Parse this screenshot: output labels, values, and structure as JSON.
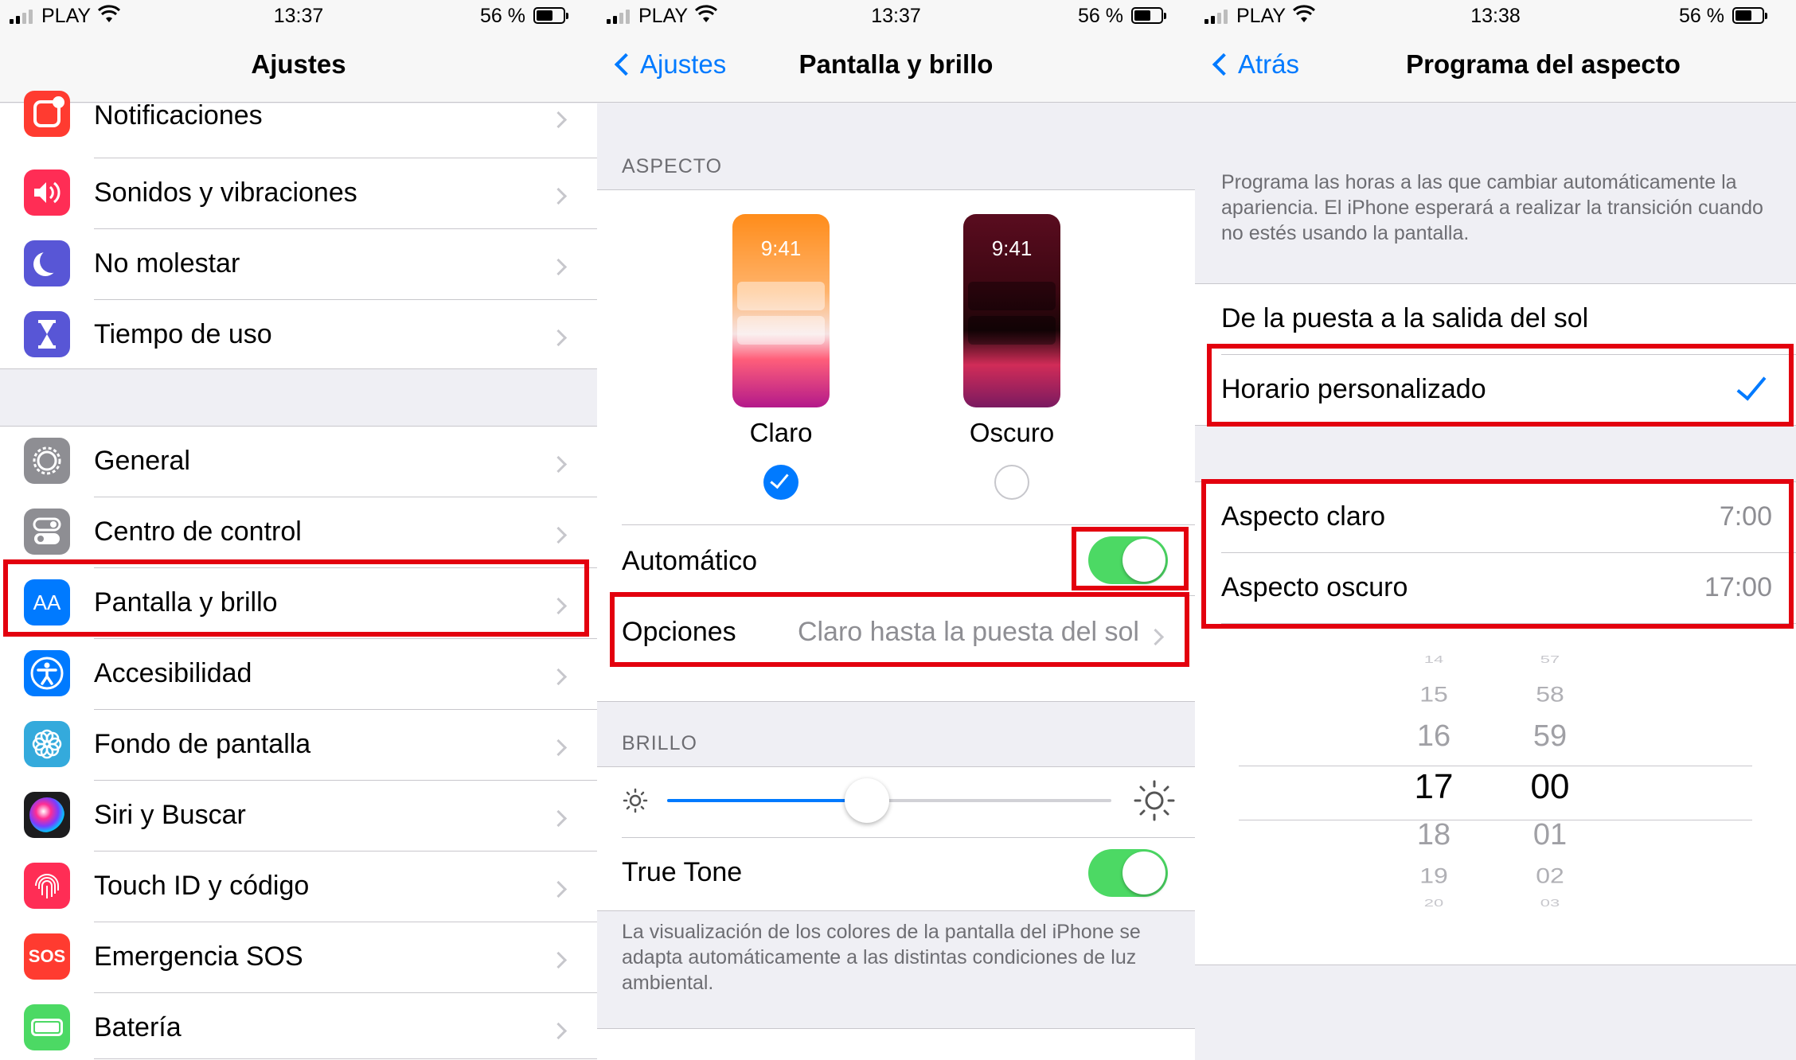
{
  "status_bars": [
    {
      "carrier": "PLAY",
      "time": "13:37",
      "battery": "56 %"
    },
    {
      "carrier": "PLAY",
      "time": "13:37",
      "battery": "56 %"
    },
    {
      "carrier": "PLAY",
      "time": "13:38",
      "battery": "56 %"
    }
  ],
  "panel1": {
    "title": "Ajustes",
    "group1": [
      {
        "label": "Notificaciones",
        "icon": "notifications-icon",
        "color": "#ff3b30"
      },
      {
        "label": "Sonidos y vibraciones",
        "icon": "speaker-icon",
        "color": "#ff2d55"
      },
      {
        "label": "No molestar",
        "icon": "moon-icon",
        "color": "#5856d6"
      },
      {
        "label": "Tiempo de uso",
        "icon": "hourglass-icon",
        "color": "#5856d6"
      }
    ],
    "group2": [
      {
        "label": "General",
        "icon": "gear-icon",
        "color": "#8e8e93"
      },
      {
        "label": "Centro de control",
        "icon": "switches-icon",
        "color": "#8e8e93"
      },
      {
        "label": "Pantalla y brillo",
        "icon": "display-icon",
        "color": "#007aff",
        "icon_text": "AA"
      },
      {
        "label": "Accesibilidad",
        "icon": "accessibility-icon",
        "color": "#007aff"
      },
      {
        "label": "Fondo de pantalla",
        "icon": "wallpaper-flower-icon",
        "color": "#34aadc"
      },
      {
        "label": "Siri y Buscar",
        "icon": "siri-icon",
        "color": "#1c1c1e"
      },
      {
        "label": "Touch ID y código",
        "icon": "fingerprint-icon",
        "color": "#ff2d55"
      },
      {
        "label": "Emergencia SOS",
        "icon": "sos-icon",
        "color": "#ff3b30",
        "icon_text": "SOS"
      },
      {
        "label": "Batería",
        "icon": "battery-icon",
        "color": "#4cd964"
      }
    ]
  },
  "panel2": {
    "back_label": "Ajustes",
    "title": "Pantalla y brillo",
    "aspect_header": "ASPECTO",
    "light": {
      "label": "Claro",
      "preview_time": "9:41",
      "selected": true
    },
    "dark": {
      "label": "Oscuro",
      "preview_time": "9:41",
      "selected": false
    },
    "automatic_label": "Automático",
    "automatic_on": true,
    "options_label": "Opciones",
    "options_value": "Claro hasta la puesta del sol",
    "brightness_header": "BRILLO",
    "brightness_level": 0.45,
    "truetone_label": "True Tone",
    "truetone_on": true,
    "truetone_note": "La visualización de los colores de la pantalla del iPhone se adapta automáticamente a las distintas condiciones de luz ambiental."
  },
  "panel3": {
    "back_label": "Atrás",
    "title": "Programa del aspecto",
    "description": "Programa las horas a las que cambiar automáticamente la apariencia. El iPhone esperará a realizar la transición cuando no estés usando la pantalla.",
    "option_sunset": "De la puesta a la salida del sol",
    "option_custom": "Horario personalizado",
    "light_label": "Aspecto claro",
    "light_time": "7:00",
    "dark_label": "Aspecto oscuro",
    "dark_time": "17:00",
    "picker_hours": [
      "14",
      "15",
      "16",
      "17",
      "18",
      "19",
      "20"
    ],
    "picker_minutes": [
      "57",
      "58",
      "59",
      "00",
      "01",
      "02",
      "03"
    ]
  },
  "colors": {
    "accent": "#007aff",
    "toggle_on": "#4cd964",
    "highlight": "#e3000e"
  }
}
